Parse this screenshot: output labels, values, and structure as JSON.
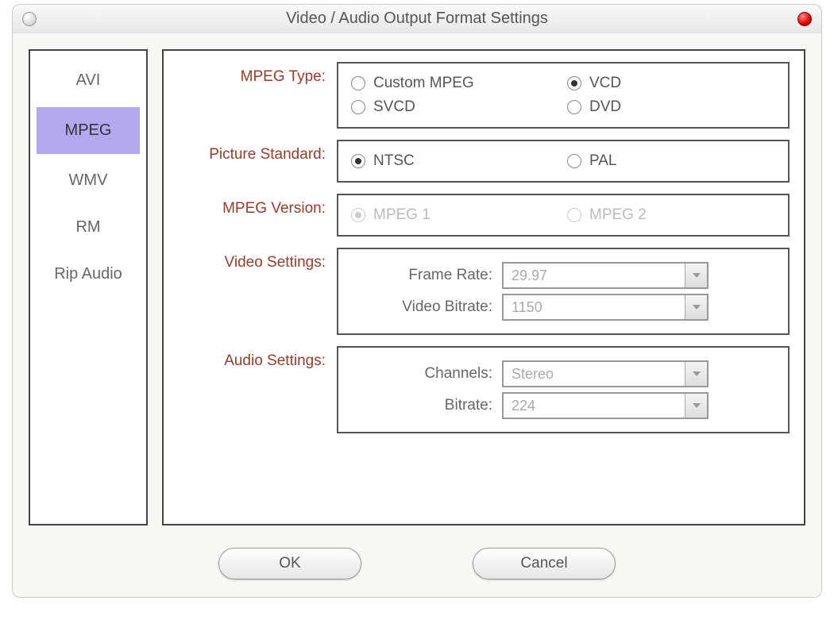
{
  "window": {
    "title": "Video / Audio Output Format Settings"
  },
  "sidebar": {
    "items": [
      {
        "label": "AVI",
        "selected": false
      },
      {
        "label": "MPEG",
        "selected": true
      },
      {
        "label": "WMV",
        "selected": false
      },
      {
        "label": "RM",
        "selected": false
      },
      {
        "label": "Rip Audio",
        "selected": false
      }
    ]
  },
  "labels": {
    "mpeg_type": "MPEG Type:",
    "picture_standard": "Picture Standard:",
    "mpeg_version": "MPEG Version:",
    "video_settings": "Video Settings:",
    "audio_settings": "Audio Settings:",
    "frame_rate": "Frame Rate:",
    "video_bitrate": "Video Bitrate:",
    "channels": "Channels:",
    "bitrate": "Bitrate:"
  },
  "mpeg_type": {
    "options": [
      {
        "label": "Custom MPEG",
        "checked": false
      },
      {
        "label": "VCD",
        "checked": true
      },
      {
        "label": "SVCD",
        "checked": false
      },
      {
        "label": "DVD",
        "checked": false
      }
    ]
  },
  "picture_standard": {
    "options": [
      {
        "label": "NTSC",
        "checked": true
      },
      {
        "label": "PAL",
        "checked": false
      }
    ]
  },
  "mpeg_version": {
    "disabled": true,
    "options": [
      {
        "label": "MPEG 1",
        "checked": true
      },
      {
        "label": "MPEG 2",
        "checked": false
      }
    ]
  },
  "video": {
    "frame_rate": "29.97",
    "bitrate": "1150"
  },
  "audio": {
    "channels": "Stereo",
    "bitrate": "224"
  },
  "buttons": {
    "ok": "OK",
    "cancel": "Cancel"
  }
}
